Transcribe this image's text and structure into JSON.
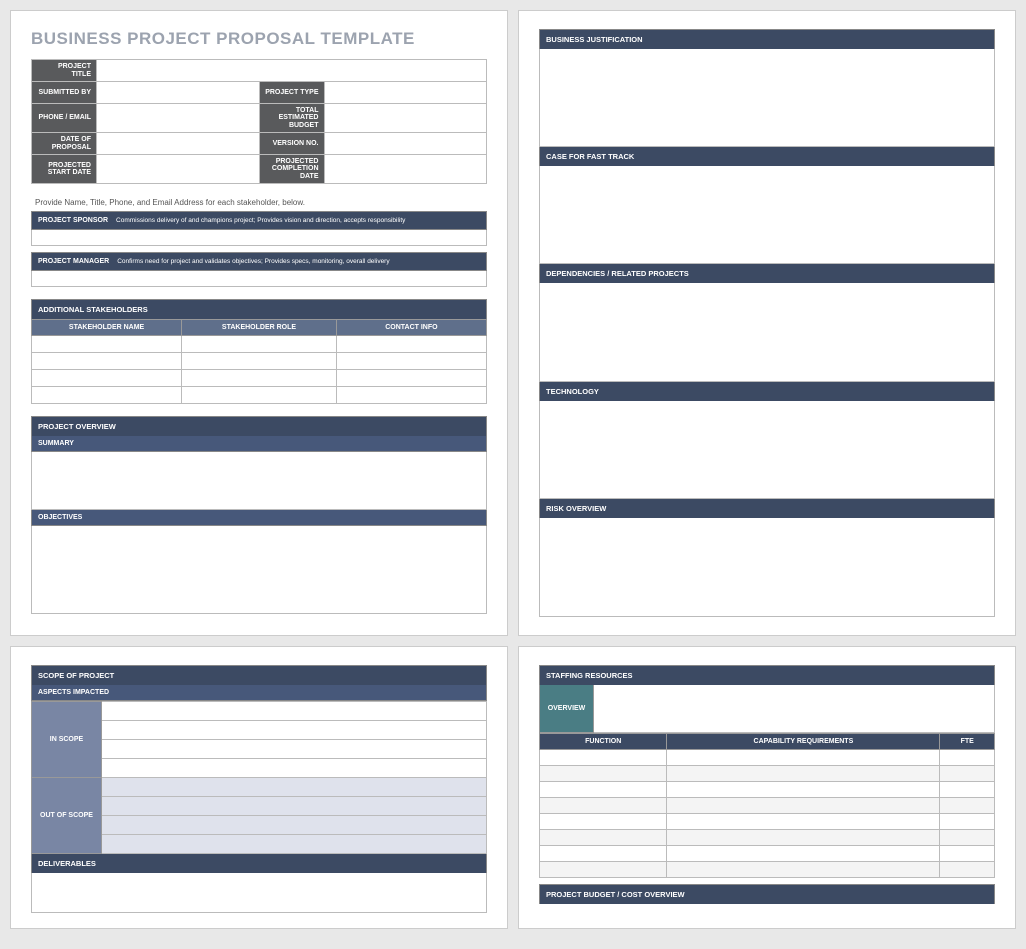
{
  "title": "BUSINESS PROJECT PROPOSAL TEMPLATE",
  "info_labels": {
    "project_title": "PROJECT TITLE",
    "submitted_by": "SUBMITTED BY",
    "project_type": "PROJECT TYPE",
    "phone_email": "PHONE / EMAIL",
    "total_budget": "TOTAL ESTIMATED BUDGET",
    "date_of_proposal": "DATE OF PROPOSAL",
    "version_no": "VERSION NO.",
    "projected_start": "PROJECTED START DATE",
    "projected_completion": "PROJECTED COMPLETION DATE"
  },
  "info_values": {
    "project_title": "",
    "submitted_by": "",
    "project_type": "",
    "phone_email": "",
    "total_budget": "",
    "date_of_proposal": "",
    "version_no": "",
    "projected_start": "",
    "projected_completion": ""
  },
  "instruction": "Provide Name, Title, Phone, and Email Address for each stakeholder, below.",
  "roles": {
    "sponsor": {
      "name": "PROJECT SPONSOR",
      "desc": "Commissions delivery of and champions project; Provides vision and direction, accepts responsibility",
      "value": ""
    },
    "manager": {
      "name": "PROJECT MANAGER",
      "desc": "Confirms need for project and validates objectives; Provides specs, monitoring, overall delivery",
      "value": ""
    }
  },
  "stakeholders": {
    "header": "ADDITIONAL STAKEHOLDERS",
    "cols": [
      "STAKEHOLDER NAME",
      "STAKEHOLDER ROLE",
      "CONTACT INFO"
    ],
    "rows": [
      [
        "",
        "",
        ""
      ],
      [
        "",
        "",
        ""
      ],
      [
        "",
        "",
        ""
      ],
      [
        "",
        "",
        ""
      ]
    ]
  },
  "project_overview": {
    "header": "PROJECT OVERVIEW",
    "summary_label": "SUMMARY",
    "summary": "",
    "objectives_label": "OBJECTIVES",
    "objectives": ""
  },
  "right_sections": {
    "business_justification": {
      "label": "BUSINESS JUSTIFICATION",
      "value": ""
    },
    "fast_track": {
      "label": "CASE FOR FAST TRACK",
      "value": ""
    },
    "dependencies": {
      "label": "DEPENDENCIES / RELATED PROJECTS",
      "value": ""
    },
    "technology": {
      "label": "TECHNOLOGY",
      "value": ""
    },
    "risk": {
      "label": "RISK OVERVIEW",
      "value": ""
    }
  },
  "scope": {
    "header": "SCOPE OF PROJECT",
    "aspects_label": "ASPECTS IMPACTED",
    "in_scope_label": "IN SCOPE",
    "out_scope_label": "OUT OF SCOPE",
    "in_rows": [
      "",
      "",
      "",
      ""
    ],
    "out_rows": [
      "",
      "",
      "",
      ""
    ],
    "deliverables_label": "DELIVERABLES",
    "deliverables": ""
  },
  "staffing": {
    "header": "STAFFING RESOURCES",
    "overview_label": "OVERVIEW",
    "overview": "",
    "cols": [
      "FUNCTION",
      "CAPABILITY REQUIREMENTS",
      "FTE"
    ],
    "rows": [
      [
        "",
        "",
        ""
      ],
      [
        "",
        "",
        ""
      ],
      [
        "",
        "",
        ""
      ],
      [
        "",
        "",
        ""
      ],
      [
        "",
        "",
        ""
      ],
      [
        "",
        "",
        ""
      ],
      [
        "",
        "",
        ""
      ],
      [
        "",
        "",
        ""
      ]
    ]
  },
  "budget": {
    "header": "PROJECT BUDGET / COST OVERVIEW"
  }
}
